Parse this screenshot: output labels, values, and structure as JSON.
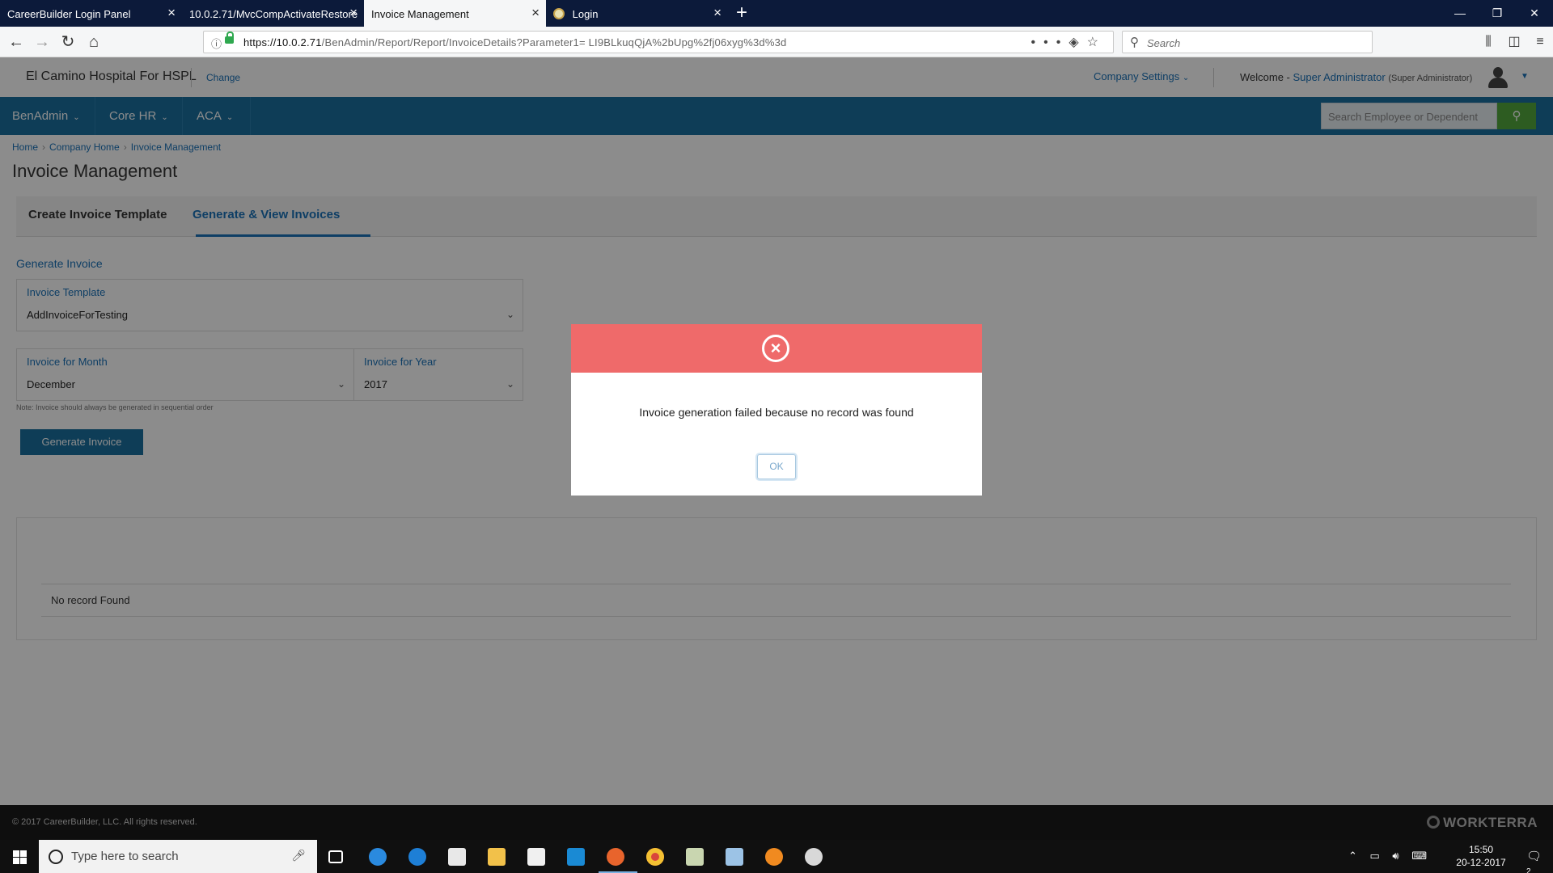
{
  "browser": {
    "tabs": [
      {
        "title": "CareerBuilder Login Panel",
        "active": false
      },
      {
        "title": "10.0.2.71/MvcCompActivateRestore",
        "active": false
      },
      {
        "title": "Invoice Management",
        "active": true
      },
      {
        "title": "Login",
        "active": false
      }
    ],
    "url_host": "https://10.0.2.71",
    "url_path": "/BenAdmin/Report/Report/InvoiceDetails?Parameter1= LI9BLkuqQjA%2bUpg%2fj06xyg%3d%3d",
    "search_placeholder": "Search"
  },
  "header": {
    "company_name": "El Camino Hospital For HSPL",
    "change_label": "Change",
    "company_settings_label": "Company Settings",
    "welcome_prefix": "Welcome -",
    "user_name": "Super Administrator",
    "user_role": "(Super Administrator)"
  },
  "mainnav": {
    "items": [
      {
        "label": "BenAdmin"
      },
      {
        "label": "Core HR"
      },
      {
        "label": "ACA"
      }
    ],
    "search_placeholder": "Search Employee or Dependent"
  },
  "breadcrumb": [
    "Home",
    "Company Home",
    "Invoice Management"
  ],
  "page_title": "Invoice Management",
  "page_tabs": [
    {
      "label": "Create Invoice Template",
      "active": false
    },
    {
      "label": "Generate & View Invoices",
      "active": true
    }
  ],
  "form": {
    "section_label": "Generate Invoice",
    "template_label": "Invoice Template",
    "template_value": "AddInvoiceForTesting",
    "month_label": "Invoice for Month",
    "month_value": "December",
    "year_label": "Invoice for Year",
    "year_value": "2017",
    "note": "Note: Invoice should always be generated in sequential order",
    "generate_button": "Generate Invoice"
  },
  "results": {
    "empty_text": "No record Found"
  },
  "footer": {
    "copyright": "© 2017 CareerBuilder, LLC. All rights reserved.",
    "brand": "WORKTERRA"
  },
  "modal": {
    "message": "Invoice generation failed because no record was found",
    "ok_label": "OK",
    "header_color": "#ef6a6a"
  },
  "taskbar": {
    "search_placeholder": "Type here to search",
    "time": "15:50",
    "date": "20-12-2017",
    "notification_count": "2"
  },
  "colors": {
    "primary_nav": "#1a6f9e",
    "link": "#1a72b8",
    "search_button": "#53a83c",
    "error": "#ef6a6a"
  }
}
